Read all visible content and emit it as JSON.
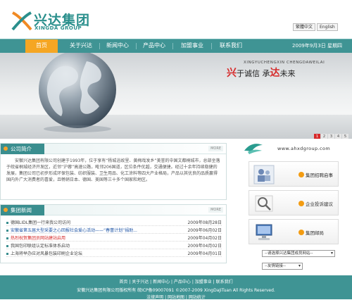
{
  "header": {
    "logo_cn": "兴达集团",
    "logo_en": "XINGDA GROUP",
    "lang_cn": "繁體中文",
    "lang_en": "English"
  },
  "nav": {
    "items": [
      "首页",
      "关于兴达",
      "新闻中心",
      "产品中心",
      "加盟事业",
      "联系我们"
    ],
    "date": "2009年9月3日 星期四"
  },
  "banner": {
    "pinyin": "XINGYUCHENGXIN CHENGDAWEILAI",
    "slogan_1": "兴",
    "slogan_2": "于诚信 承",
    "slogan_3": "达",
    "slogan_4": "未来",
    "pages": [
      "1",
      "2",
      "3",
      "4",
      "5"
    ]
  },
  "intro": {
    "title": "公司简介",
    "more": "MORE",
    "text": "安徽兴达集团有限公司创建于1993年，位于享有“杨城浴故里、黄梅戏发乡”美誉的中国文都桐城市，总部坐落于皖省桐城经济开发区，近邻“沪蓉”高速公路，毗邻206国道，区位条件优越，交通便捷。经过十余年持续稳健的发展，集团公司已初步形成环保包装、纺织服装、卫生用品、化工涂料等四大产业格局，产品以其优良的品质赢得国内外广大消费者的喜爱，且畅销日本、德国、美国等三十多个国家和地区。"
  },
  "news": {
    "title": "集团新闻",
    "more": "MORE",
    "items": [
      {
        "title": "德国LIDL集团一行来我公司访问",
        "date": "2009年08月28日",
        "color": "#444444"
      },
      {
        "title": "安徽省第五届大型采要之心回报社会爱心活动——“春蕾计划”捐助...",
        "date": "2009年06月02日",
        "color": "#1f55a6"
      },
      {
        "title": "热烈祝贺集团员网站建站启用",
        "date": "2009年04月02日",
        "color": "#d62a2a"
      },
      {
        "title": "我国包印联组认定标准体系启动",
        "date": "2009年04月02日",
        "color": "#444444"
      },
      {
        "title": "上海将举办应对风暴包装印刷企业论坛",
        "date": "2009年04月01日",
        "color": "#444444"
      }
    ]
  },
  "side": {
    "url": "www.ahxdgroup.com",
    "recruit": "集团招聘启事",
    "complaint": "企业投诉建议",
    "mail": "集团邮局",
    "select_group": "--请选择兴达集团成员网站--",
    "select_links": "--友情链接--"
  },
  "footer": {
    "links": "首页 | 关于兴达 | 新闻中心 | 产品中心 | 加盟事业 | 联系我们",
    "copyright": "安徽兴达集团有限公司版权所有 皖ICP备09007091 ©2007-2009 XingDaJiTuan All Rights Reserved.",
    "links2": "法律声明 | 网站地图 | 网站统计"
  },
  "colors": {
    "teal": "#3f9494",
    "orange": "#f5a623",
    "red": "#d62a2a"
  }
}
